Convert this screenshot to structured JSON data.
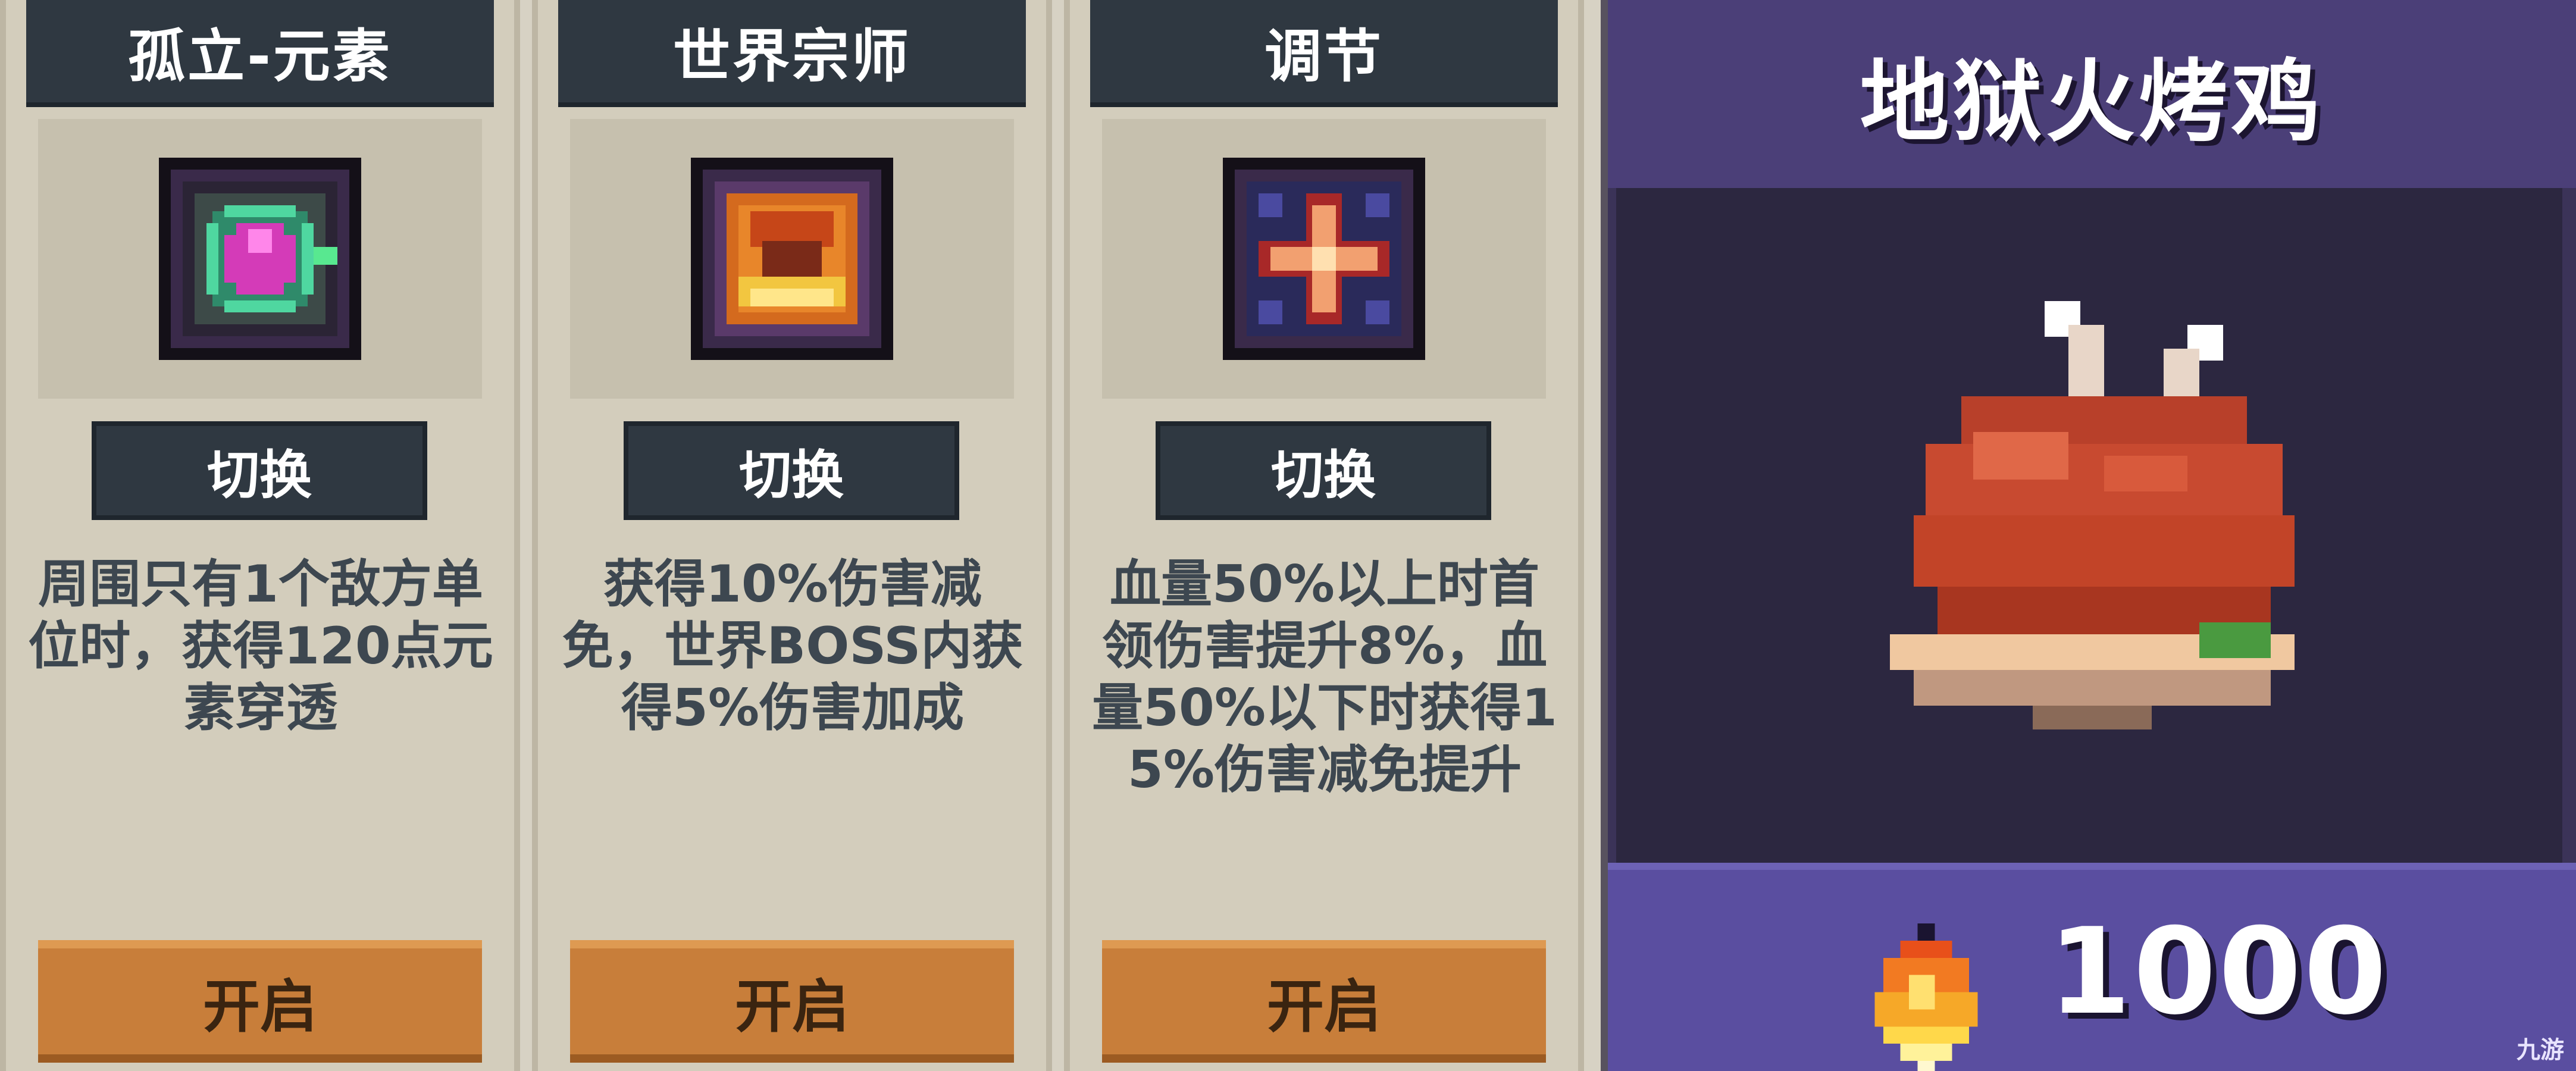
{
  "cards": [
    {
      "title": "孤立-元素",
      "icon": "green-element-gem-icon",
      "switch_label": "切换",
      "description": "周围只有1个敌方单位时，获得120点元素穿透",
      "open_label": "开启"
    },
    {
      "title": "世界宗师",
      "icon": "golden-master-emblem-icon",
      "switch_label": "切换",
      "description": "获得10%伤害减免，世界BOSS内获得5%伤害加成",
      "open_label": "开启"
    },
    {
      "title": "调节",
      "icon": "red-cross-star-icon",
      "switch_label": "切换",
      "description": "血量50%以上时首领伤害提升8%，血量50%以下时获得15%伤害减免提升",
      "open_label": "开启"
    }
  ],
  "shop_item": {
    "name": "地狱火烤鸡",
    "image": "roast-chicken-icon",
    "currency_icon": "fire-gem-icon",
    "price": "1000"
  },
  "watermark": "九游",
  "colors": {
    "card_header": "#2f3841",
    "open_button": "#c87e3a",
    "shop_panel": "#4b3f78",
    "price_bar": "#5a4ea0"
  }
}
